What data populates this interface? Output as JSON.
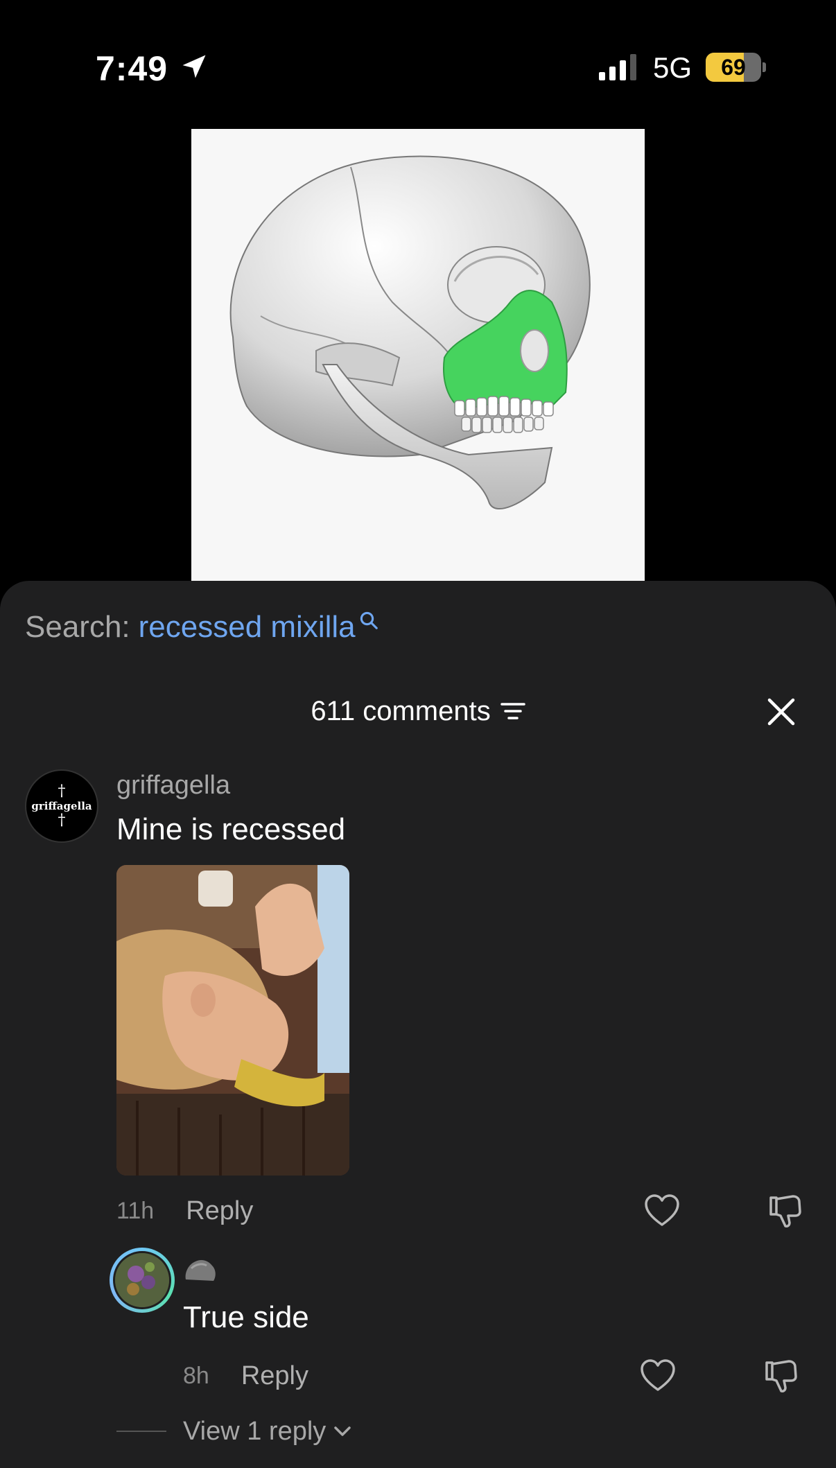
{
  "status_bar": {
    "time": "7:49",
    "network": "5G",
    "battery_percent": "69",
    "battery_level": 0.69,
    "battery_color": "#f3c93f"
  },
  "search": {
    "label": "Search:",
    "query": "recessed mixilla"
  },
  "comments_header": {
    "count_label": "611 comments"
  },
  "comment": {
    "avatar_text": "griffagella",
    "username": "griffagella",
    "text": "Mine is recessed",
    "time": "11h",
    "reply_label": "Reply"
  },
  "reply": {
    "text": "True side",
    "time": "8h",
    "reply_label": "Reply",
    "view_replies_label": "View 1 reply"
  },
  "colors": {
    "sheet_background": "#1f1f20",
    "link_blue": "#6fa6f0",
    "highlight_green": "#46d35e"
  }
}
